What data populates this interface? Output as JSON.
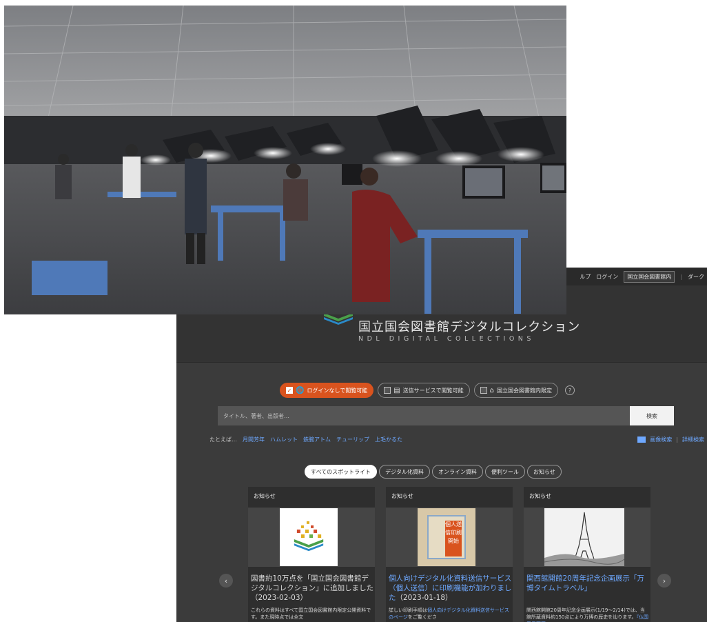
{
  "topnav": {
    "help": "ルプ",
    "login": "ログイン",
    "location": "国立国会図書館内",
    "dark": "ダーク"
  },
  "header": {
    "title_jp": "国立国会図書館デジタルコレクション",
    "title_en": "NDL DIGITAL COLLECTIONS"
  },
  "filters": [
    {
      "label": "ログインなしで閲覧可能",
      "checked": true
    },
    {
      "label": "送信サービスで閲覧可能",
      "checked": false
    },
    {
      "label": "国立国会図書館内限定",
      "checked": false
    }
  ],
  "search": {
    "placeholder": "タイトル、著者、出版者…",
    "button": "検索"
  },
  "examples": {
    "prefix": "たとえば…",
    "items": [
      "月間芳年",
      "ハムレット",
      "鉄腕アトム",
      "チューリップ",
      "上毛かるた"
    ]
  },
  "links": {
    "image_search": "画像検索",
    "advanced_search": "詳細検索"
  },
  "tabs": [
    {
      "label": "すべてのスポットライト",
      "active": true
    },
    {
      "label": "デジタル化資料",
      "active": false
    },
    {
      "label": "オンライン資料",
      "active": false
    },
    {
      "label": "便利ツール",
      "active": false
    },
    {
      "label": "お知らせ",
      "active": false
    }
  ],
  "cards": [
    {
      "category": "お知らせ",
      "title": "図書約10万点を「国立国会図書館デジタルコレクション」に追加しました（2023-02-03）",
      "desc": "これらの資料はすべて国立国会図書館内限定公開資料です。また現時点では全文"
    },
    {
      "category": "お知らせ",
      "title": "個人向けデジタル化資料送信サービス（個人送信）に印刷機能が加わりました",
      "date": "（2023-01-18）",
      "desc_pre": "詳しい印刷手順は",
      "desc_link": "個人向けデジタル化資料送信サービスのページ",
      "desc_post": "をご覧くださ",
      "thumb_text": "個人送信印刷開始"
    },
    {
      "category": "お知らせ",
      "title": "関西館開館20周年記念企画展示「万博タイムトラベル」",
      "desc_pre": "関西館開館20周年記念企画展示(1/19〜2/14)では、当館所蔵資料約150点により万博の歴史を辿ります。",
      "desc_link": "『仏国巴里万国"
    }
  ],
  "colors": {
    "accent": "#d9531e",
    "link": "#6ea8ff",
    "background": "#3b3b3b"
  },
  "icons": {
    "prev": "‹",
    "next": "›",
    "help": "?",
    "check": "✓"
  }
}
